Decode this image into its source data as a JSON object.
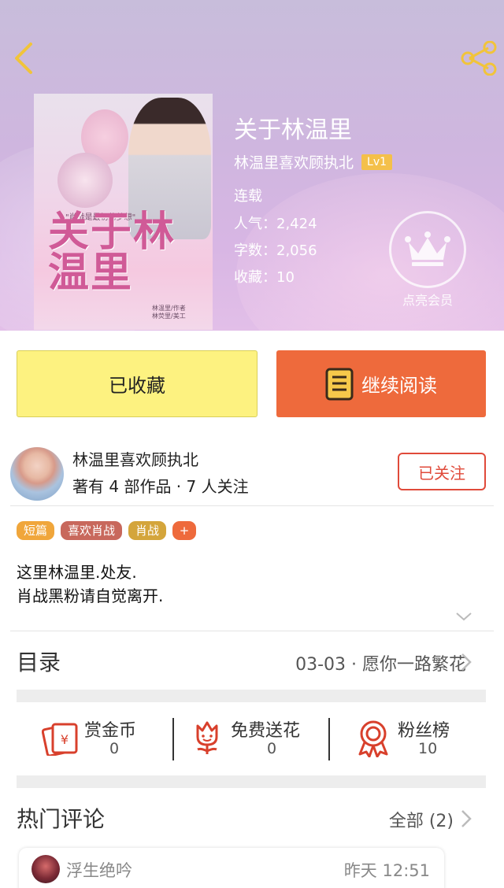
{
  "book": {
    "title": "关于林温里",
    "author": "林温里喜欢顾执北",
    "level_badge": "Lv1",
    "status": "连载",
    "popularity": "人气：2,424",
    "word_count": "字数：2,056",
    "favorites": "收藏：10",
    "vip_label": "点亮会员",
    "cover": {
      "title": "关于林温里",
      "tagline": "\"肖战是最初的梦想\"",
      "credit_line1": "林温里/作者",
      "credit_line2": "林荧里/美工"
    }
  },
  "buttons": {
    "collected": "已收藏",
    "continue_reading": "继续阅读"
  },
  "author_panel": {
    "name": "林温里喜欢顾执北",
    "meta": "著有 4 部作品 · 7 人关注",
    "follow_label": "已关注"
  },
  "tags": [
    {
      "label": "短篇",
      "color": "#f0a63b"
    },
    {
      "label": "喜欢肖战",
      "color": "#c8685c"
    },
    {
      "label": "肖战",
      "color": "#d4a53b"
    },
    {
      "label": "+",
      "color": "#ee6a3c"
    }
  ],
  "description": {
    "line1": "这里林温里.处友.",
    "line2": "肖战黑粉请自觉离开."
  },
  "toc": {
    "label": "目录",
    "latest": "03-03 · 愿你一路繁花"
  },
  "actions": [
    {
      "name": "赏金币",
      "count": "0",
      "icon": "coin-envelope-icon"
    },
    {
      "name": "免费送花",
      "count": "0",
      "icon": "flower-icon"
    },
    {
      "name": "粉丝榜",
      "count": "10",
      "icon": "ribbon-medal-icon"
    }
  ],
  "comments_section": {
    "label": "热门评论",
    "all_label": "全部 (2)"
  },
  "comments": [
    {
      "user": "浮生绝吟",
      "time": "昨天 12:51"
    }
  ],
  "colors": {
    "accent": "#ee6a3c",
    "follow_red": "#e04a3a",
    "collect_yellow": "#fdf280",
    "level_badge": "#f4c04a"
  }
}
